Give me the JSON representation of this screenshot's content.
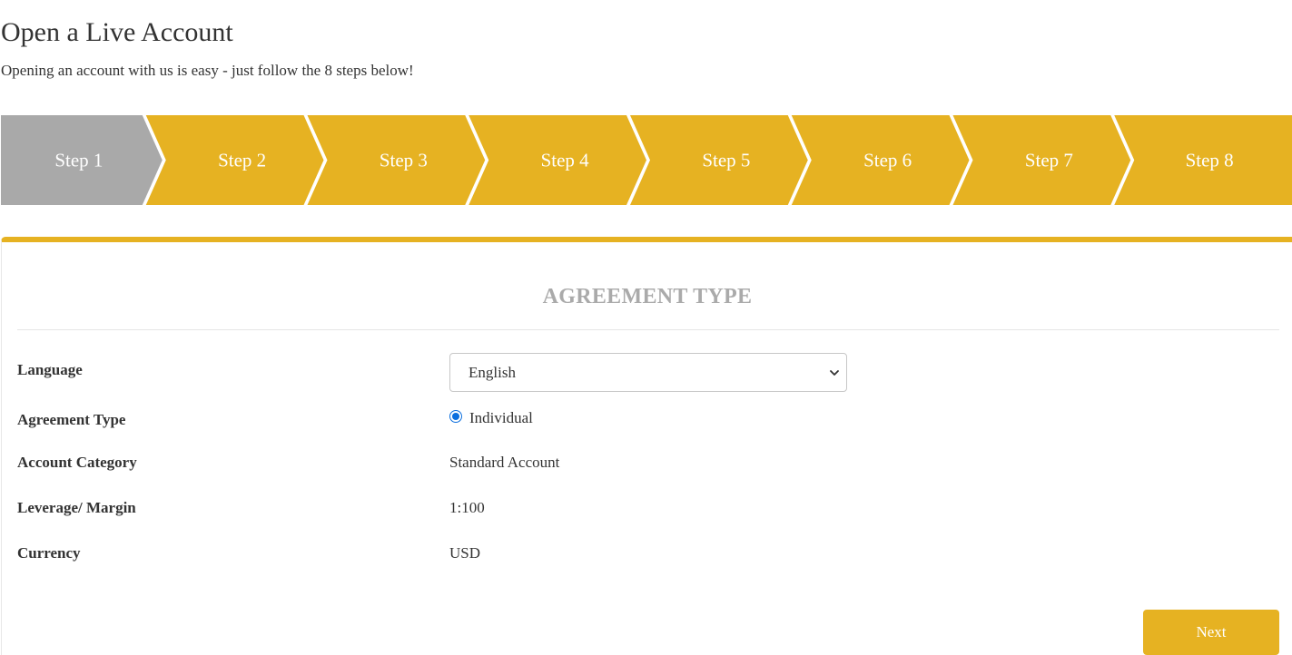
{
  "header": {
    "title": "Open a Live Account",
    "subtitle": "Opening an account with us is easy - just follow the 8 steps below!"
  },
  "steps": {
    "active_index": 0,
    "items": [
      {
        "label": "Step 1"
      },
      {
        "label": "Step 2"
      },
      {
        "label": "Step 3"
      },
      {
        "label": "Step 4"
      },
      {
        "label": "Step 5"
      },
      {
        "label": "Step 6"
      },
      {
        "label": "Step 7"
      },
      {
        "label": "Step 8"
      }
    ],
    "colors": {
      "active": "#a9a9a9",
      "inactive": "#e6b222",
      "text": "#ffffff"
    }
  },
  "form": {
    "heading": "AGREEMENT TYPE",
    "language": {
      "label": "Language",
      "selected": "English"
    },
    "agreement_type": {
      "label": "Agreement Type",
      "option": "Individual",
      "checked": true
    },
    "account_category": {
      "label": "Account Category",
      "value": "Standard Account"
    },
    "leverage": {
      "label": "Leverage/ Margin",
      "value": "1:100"
    },
    "currency": {
      "label": "Currency",
      "value": "USD"
    },
    "next_label": "Next"
  },
  "colors": {
    "accent": "#e6b222",
    "radio": "#0a6ede",
    "heading": "#aaaaaa"
  }
}
